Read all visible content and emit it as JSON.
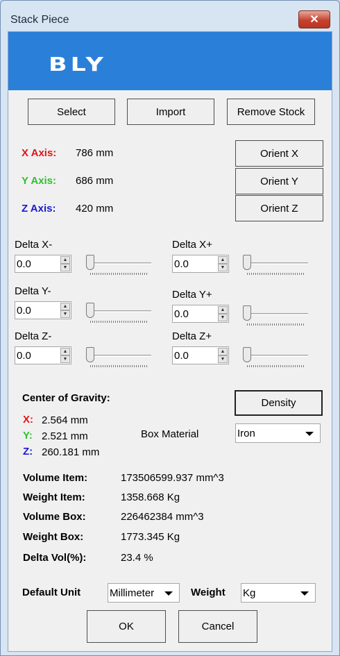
{
  "window": {
    "title": "Stack Piece",
    "close_label": "✕"
  },
  "banner": {
    "logo_text": "BLY"
  },
  "toolbar": {
    "select_label": "Select",
    "import_label": "Import",
    "remove_stock_label": "Remove Stock"
  },
  "axes": {
    "x": {
      "label": "X Axis:",
      "value": "786 mm",
      "orient_label": "Orient X",
      "color": "#e01515"
    },
    "y": {
      "label": "Y Axis:",
      "value": "686 mm",
      "orient_label": "Orient Y",
      "color": "#2ec02e"
    },
    "z": {
      "label": "Z Axis:",
      "value": "420 mm",
      "orient_label": "Orient Z",
      "color": "#1a1acc"
    }
  },
  "deltas": [
    {
      "label": "Delta X-",
      "value": "0.0",
      "slider_level": 0
    },
    {
      "label": "Delta X+",
      "value": "0.0",
      "slider_level": 0
    },
    {
      "label": "Delta Y-",
      "value": "0.0",
      "slider_level": 0
    },
    {
      "label": "Delta Y+",
      "value": "0.0",
      "slider_level": 0
    },
    {
      "label": "Delta Z-",
      "value": "0.0",
      "slider_level": 0
    },
    {
      "label": "Delta Z+",
      "value": "0.0",
      "slider_level": 0
    }
  ],
  "gravity": {
    "heading": "Center of Gravity:",
    "x_label": "X:",
    "x_value": "2.564 mm",
    "y_label": "Y:",
    "y_value": "2.521 mm",
    "z_label": "Z:",
    "z_value": "260.181 mm"
  },
  "density_label": "Density",
  "box_material": {
    "label": "Box Material",
    "value": "Iron"
  },
  "stats": [
    {
      "label": "Volume Item:",
      "value": "173506599.937 mm^3"
    },
    {
      "label": "Weight Item:",
      "value": "1358.668 Kg"
    },
    {
      "label": "Volume Box:",
      "value": "226462384 mm^3"
    },
    {
      "label": "Weight Box:",
      "value": "1773.345 Kg"
    },
    {
      "label": "Delta Vol(%):",
      "value": "23.4 %"
    }
  ],
  "units": {
    "default_unit_label": "Default Unit",
    "default_unit_value": "Millimeter",
    "weight_label": "Weight",
    "weight_value": "Kg"
  },
  "footer": {
    "ok_label": "OK",
    "cancel_label": "Cancel"
  }
}
